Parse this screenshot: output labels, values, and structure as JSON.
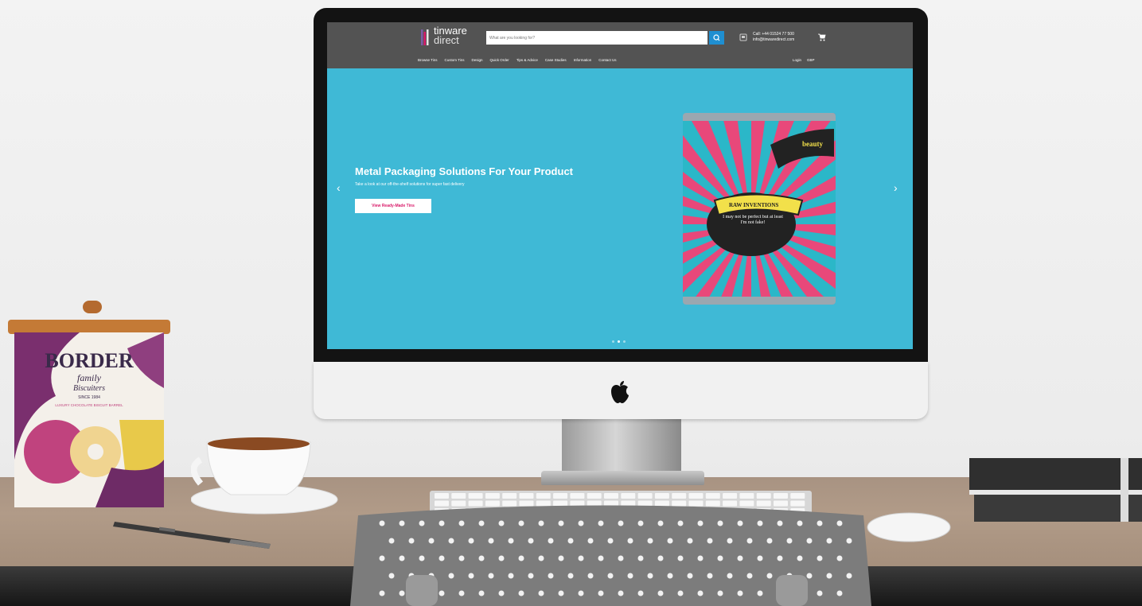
{
  "site": {
    "logo_line1": "tinware",
    "logo_line2": "direct",
    "search_placeholder": "What are you looking for?",
    "phone": "Call: +44 01524 77 500",
    "email": "info@tinwaredirect.com",
    "nav": [
      "Browse Tins",
      "Custom Tins",
      "Design",
      "Quick Order",
      "Tips & Advice",
      "Case Studies",
      "Information",
      "Contact Us"
    ],
    "nav_right": [
      "Login",
      "GBP"
    ],
    "hero": {
      "title": "Metal Packaging Solutions For Your Product",
      "subtitle": "Take a look at our off-the-shelf solutions for super fast delivery",
      "button": "View Ready-Made Tins"
    },
    "carousel_count": 3,
    "carousel_active": 2
  },
  "products": {
    "tin_top_text": "beauty",
    "tin_banner": "RAW INVENTIONS",
    "tin_quote": "I may not be perfect but at least I'm not fake!",
    "border_brand": "BORDER",
    "border_sub1": "family",
    "border_sub2": "Biscuiters",
    "border_since": "SINCE 1984",
    "border_desc": "LUXURY CHOCOLATE BISCUIT BARREL"
  },
  "colors": {
    "hero_bg": "#3fb9d6",
    "topbar": "#535353",
    "accent_pink": "#d91b6a",
    "search_btn": "#1f8fd1"
  }
}
